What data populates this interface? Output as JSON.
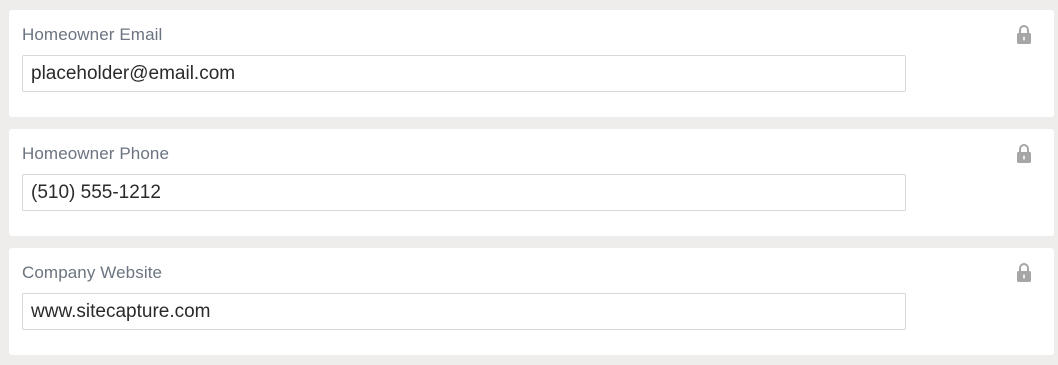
{
  "fields": [
    {
      "label": "Homeowner Email",
      "value": "placeholder@email.com",
      "icon": "lock-icon"
    },
    {
      "label": "Homeowner Phone",
      "value": "(510) 555-1212",
      "icon": "lock-icon"
    },
    {
      "label": "Company Website",
      "value": "www.sitecapture.com",
      "icon": "lock-icon"
    }
  ],
  "colors": {
    "page_bg": "#eeedeb",
    "card_bg": "#ffffff",
    "label": "#6b7480",
    "input_text": "#2a2a2a",
    "input_border": "#d8d8d8",
    "lock": "#a6a6a6"
  }
}
